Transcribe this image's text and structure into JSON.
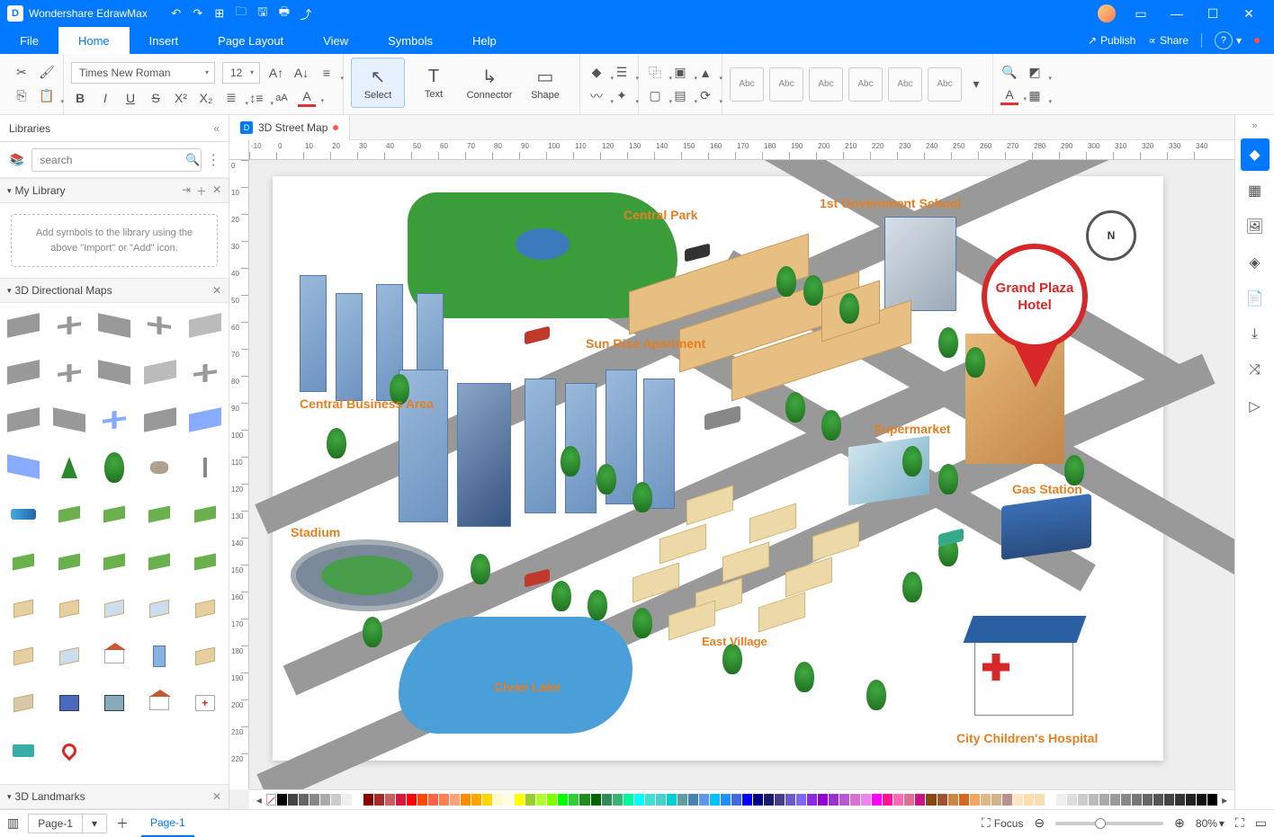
{
  "app": {
    "title": "Wondershare EdrawMax"
  },
  "menu": {
    "items": [
      "File",
      "Home",
      "Insert",
      "Page Layout",
      "View",
      "Symbols",
      "Help"
    ],
    "active": 1,
    "publish": "Publish",
    "share": "Share"
  },
  "ribbon": {
    "font_name": "Times New Roman",
    "font_size": "12",
    "tools": {
      "select": "Select",
      "text": "Text",
      "connector": "Connector",
      "shape": "Shape"
    },
    "themes": [
      "Abc",
      "Abc",
      "Abc",
      "Abc",
      "Abc",
      "Abc"
    ]
  },
  "libraries": {
    "title": "Libraries",
    "search_placeholder": "search",
    "sections": {
      "my": "My Library",
      "maps": "3D Directional Maps",
      "landmarks": "3D Landmarks"
    },
    "drop_hint": "Add symbols to the library using the above \"Import\" or \"Add\" icon."
  },
  "document": {
    "tab": "3D Street Map"
  },
  "ruler": {
    "h": [
      "-10",
      "0",
      "10",
      "20",
      "30",
      "40",
      "50",
      "60",
      "70",
      "80",
      "90",
      "100",
      "110",
      "120",
      "130",
      "140",
      "150",
      "160",
      "170",
      "180",
      "190",
      "200",
      "210",
      "220",
      "230",
      "240",
      "250",
      "260",
      "270",
      "280",
      "290",
      "300",
      "310",
      "320",
      "330",
      "340"
    ],
    "v": [
      "0",
      "10",
      "20",
      "30",
      "40",
      "50",
      "60",
      "70",
      "80",
      "90",
      "100",
      "110",
      "120",
      "130",
      "140",
      "150",
      "160",
      "170",
      "180",
      "190",
      "200",
      "210",
      "220"
    ]
  },
  "map": {
    "central_park": "Central Park",
    "gov_school": "1st Government School",
    "sunrise": "Sun Rise Apartment",
    "cba": "Central Business Area",
    "supermarket": "Supermarket",
    "gas": "Gas Station",
    "stadium": "Stadium",
    "east_village": "East Village",
    "lake": "Civan Lake",
    "hospital": "City Children's Hospital",
    "hotel": "Grand Plaza Hotel",
    "compass": "N"
  },
  "colorbar": [
    "#000",
    "#444",
    "#666",
    "#888",
    "#aaa",
    "#ccc",
    "#eee",
    "#fff",
    "#8b0000",
    "#a52a2a",
    "#cd5c5c",
    "#dc143c",
    "#ff0000",
    "#ff4500",
    "#ff6347",
    "#ff7f50",
    "#ffa07a",
    "#ff8c00",
    "#ffa500",
    "#ffd700",
    "#fffacd",
    "#ffffe0",
    "#ffff00",
    "#9acd32",
    "#adff2f",
    "#7fff00",
    "#00ff00",
    "#32cd32",
    "#228b22",
    "#006400",
    "#2e8b57",
    "#3cb371",
    "#00fa9a",
    "#00ffff",
    "#40e0d0",
    "#48d1cc",
    "#00ced1",
    "#5f9ea0",
    "#4682b4",
    "#6495ed",
    "#00bfff",
    "#1e90ff",
    "#4169e1",
    "#0000ff",
    "#00008b",
    "#191970",
    "#483d8b",
    "#6a5acd",
    "#7b68ee",
    "#8a2be2",
    "#9400d3",
    "#9932cc",
    "#ba55d3",
    "#da70d6",
    "#ee82ee",
    "#ff00ff",
    "#ff1493",
    "#ff69b4",
    "#db7093",
    "#c71585",
    "#8b4513",
    "#a0522d",
    "#cd853f",
    "#d2691e",
    "#f4a460",
    "#deb887",
    "#d2b48c",
    "#bc8f8f",
    "#ffe4c4",
    "#ffdead",
    "#f5deb3",
    "#fff",
    "#eee",
    "#ddd",
    "#ccc",
    "#bbb",
    "#aaa",
    "#999",
    "#888",
    "#777",
    "#666",
    "#555",
    "#444",
    "#333",
    "#222",
    "#111",
    "#000"
  ],
  "status": {
    "page": "Page-1",
    "focus": "Focus",
    "zoom": "80%"
  }
}
